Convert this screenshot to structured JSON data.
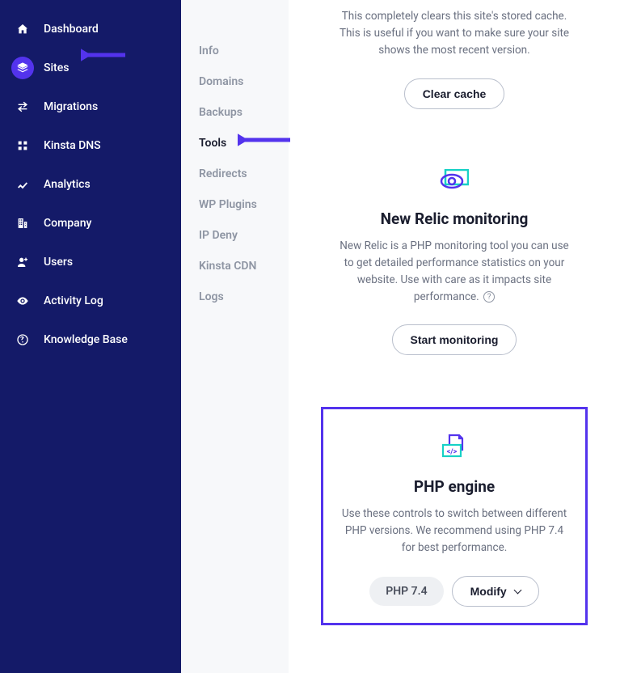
{
  "sidebar": {
    "items": [
      {
        "label": "Dashboard"
      },
      {
        "label": "Sites"
      },
      {
        "label": "Migrations"
      },
      {
        "label": "Kinsta DNS"
      },
      {
        "label": "Analytics"
      },
      {
        "label": "Company"
      },
      {
        "label": "Users"
      },
      {
        "label": "Activity Log"
      },
      {
        "label": "Knowledge Base"
      }
    ]
  },
  "subnav": {
    "items": [
      {
        "label": "Info"
      },
      {
        "label": "Domains"
      },
      {
        "label": "Backups"
      },
      {
        "label": "Tools"
      },
      {
        "label": "Redirects"
      },
      {
        "label": "WP Plugins"
      },
      {
        "label": "IP Deny"
      },
      {
        "label": "Kinsta CDN"
      },
      {
        "label": "Logs"
      }
    ]
  },
  "cards": {
    "cache": {
      "desc": "This completely clears this site's stored cache. This is useful if you want to make sure your site shows the most recent version.",
      "button": "Clear cache"
    },
    "newrelic": {
      "title": "New Relic monitoring",
      "desc": "New Relic is a PHP monitoring tool you can use to get detailed performance statistics on your website. Use with care as it impacts site performance. ",
      "button": "Start monitoring"
    },
    "php": {
      "title": "PHP engine",
      "desc": "Use these controls to switch between different PHP versions. We recommend using PHP 7.4 for best performance.",
      "version": "PHP 7.4",
      "modify": "Modify"
    }
  }
}
